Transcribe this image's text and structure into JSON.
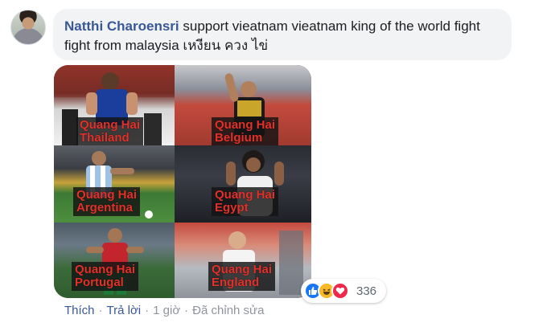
{
  "comment": {
    "author": "Natthi Charoensri",
    "text": " support vieatnam vieatnam king of the world fight fight from malaysia เหงียน ควง ไข่"
  },
  "image": {
    "tiles": [
      {
        "line1": "Quang Hai",
        "line2": "Thailand"
      },
      {
        "line1": "Quang Hai",
        "line2": "Belgium"
      },
      {
        "line1": "Quang Hai",
        "line2": "Argentina"
      },
      {
        "line1": "Quang Hai",
        "line2": "Egypt"
      },
      {
        "line1": "Quang Hai",
        "line2": "Portugal"
      },
      {
        "line1": "Quang Hai",
        "line2": "England"
      }
    ]
  },
  "reactions": {
    "icons": [
      "like-icon",
      "haha-icon",
      "love-icon"
    ],
    "count": "336",
    "colors": {
      "like": "#1877f2",
      "haha": "#f7b928",
      "love": "#f0284a"
    }
  },
  "actions": {
    "like": "Thích",
    "reply": "Trả lời",
    "separator": "·",
    "time": "1 giờ",
    "edited": "Đã chỉnh sửa"
  },
  "colors": {
    "link": "#385898",
    "meta": "#90949c",
    "bubble": "#f2f3f5",
    "caption": "#e3322b"
  }
}
